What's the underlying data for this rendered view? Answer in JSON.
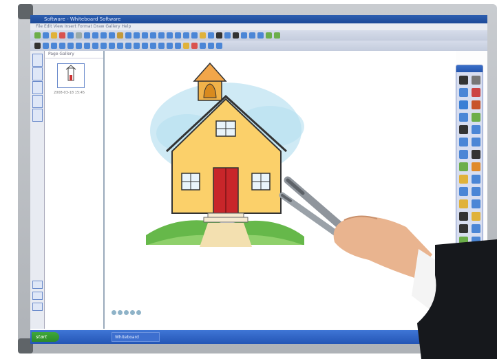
{
  "window": {
    "title": "Software - Whiteboard Software"
  },
  "menubar": {
    "text": "File  Edit  View  Insert  Format  Draw  Gallery  Help"
  },
  "sorter": {
    "tab_label": "Page  Gallery",
    "thumb_caption": "2008-03-18  15:45"
  },
  "taskbar": {
    "start_label": "start",
    "task_label": "Whiteboard"
  },
  "colors": {
    "accent": "#2455ad",
    "frame": "#aeb2b7",
    "desktop_green": "#3fa83a",
    "tray": "#1a8ee0"
  },
  "toolbar_row1_icons": [
    "#6cae4a",
    "#4b86d6",
    "#e0b23a",
    "#d9534f",
    "#4b86d6",
    "#9aa",
    "#4b86d6",
    "#4b86d6",
    "#4b86d6",
    "#4b86d6",
    "#c49a3a",
    "#4b86d6",
    "#4b86d6",
    "#4b86d6",
    "#4b86d6",
    "#4b86d6",
    "#4b86d6",
    "#4b86d6",
    "#4b86d6",
    "#4b86d6",
    "#e0b23a",
    "#4b86d6",
    "#333",
    "#4b86d6",
    "#333",
    "#4b86d6",
    "#4b86d6",
    "#4b86d6",
    "#6cae4a",
    "#6cae4a"
  ],
  "toolbar_row2_icons": [
    "#333",
    "#4b86d6",
    "#4b86d6",
    "#4b86d6",
    "#4b86d6",
    "#4b86d6",
    "#4b86d6",
    "#4b86d6",
    "#4b86d6",
    "#4b86d6",
    "#4b86d6",
    "#4b86d6",
    "#4b86d6",
    "#4b86d6",
    "#4b86d6",
    "#4b86d6",
    "#4b86d6",
    "#4b86d6",
    "#e0b23a",
    "#d9534f",
    "#4b86d6",
    "#4b86d6",
    "#4b86d6"
  ],
  "palette_tools": [
    "#333",
    "#777",
    "#4b86d6",
    "#c44",
    "#3a7fd5",
    "#c8552b",
    "#4b86d6",
    "#6cae4a",
    "#333",
    "#4b86d6",
    "#4b86d6",
    "#4b86d6",
    "#4b86d6",
    "#333",
    "#6cae4a",
    "#e08a2a",
    "#e0b23a",
    "#4b86d6",
    "#4b86d6",
    "#4b86d6",
    "#e0b23a",
    "#4b86d6",
    "#333",
    "#e0b23a",
    "#333",
    "#4b86d6",
    "#6cae4a",
    "#4b86d6",
    "#6cae4a",
    "#6cae4a",
    "#4b86d6",
    "#c44"
  ]
}
